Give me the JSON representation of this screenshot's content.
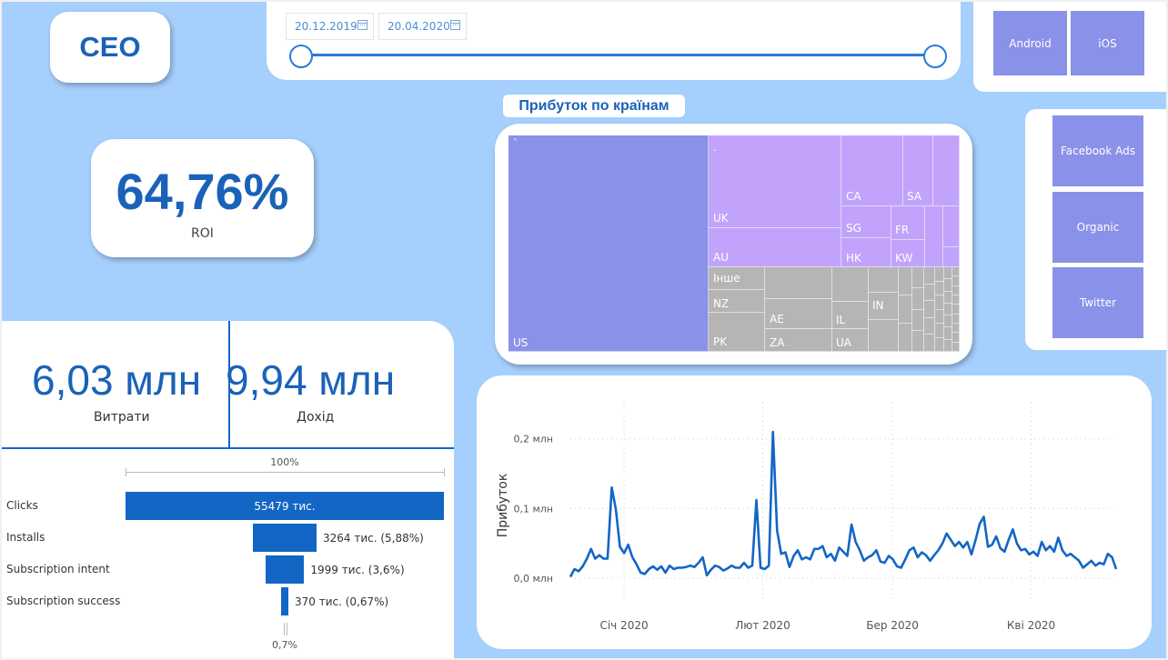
{
  "header": {
    "title": "CEO"
  },
  "date_filter": {
    "start": "20.12.2019",
    "end": "20.04.2020"
  },
  "platform_filter": {
    "options": [
      "Android",
      "iOS"
    ]
  },
  "channel_filter": {
    "options": [
      "Facebook Ads",
      "Organic",
      "Twitter"
    ]
  },
  "roi": {
    "value": "64,76%",
    "label": "ROI"
  },
  "treemap": {
    "title": "Прибуток по країнам",
    "labels": {
      "us": "US",
      "uk": "UK",
      "au": "AU",
      "ca": "CA",
      "sa": "SA",
      "sg": "SG",
      "fr": "FR",
      "hk": "HK",
      "kw": "KW",
      "other": "Інше",
      "nz": "NZ",
      "pk": "PK",
      "ae": "AE",
      "za": "ZA",
      "il": "IL",
      "ua": "UA",
      "in": "IN",
      "tick1": "`",
      "tick2": "."
    },
    "colors": {
      "group1": "#8a91e8",
      "group2": "#c1a3fb",
      "group3": "#b5b5b5"
    }
  },
  "kpis": {
    "spend": {
      "value": "6,03 млн",
      "label": "Витрати"
    },
    "revenue": {
      "value": "9,94 млн",
      "label": "Дохід"
    }
  },
  "funnel": {
    "top_percent": "100%",
    "bottom_percent": "0,7%",
    "stages": [
      {
        "label": "Clicks",
        "value_text": "55479 тис.",
        "share": 1.0
      },
      {
        "label": "Installs",
        "value_text": "3264 тис. (5,88%)",
        "share": 0.0588
      },
      {
        "label": "Subscription intent",
        "value_text": "1999 тис. (3,6%)",
        "share": 0.036
      },
      {
        "label": "Subscription success",
        "value_text": "370 тис. (0,67%)",
        "share": 0.0067
      }
    ]
  },
  "chart_data": {
    "type": "line",
    "title": "",
    "xlabel": "",
    "ylabel": "Прибуток",
    "x_range": [
      "2019-12-20",
      "2020-04-20"
    ],
    "x_ticks": [
      "Січ 2020",
      "Лют 2020",
      "Бер 2020",
      "Кві 2020"
    ],
    "y_ticks": [
      "0,0 млн",
      "0,1 млн",
      "0,2 млн"
    ],
    "ylim": [
      0,
      0.21
    ],
    "grid": true,
    "series": [
      {
        "values": [
          0.002,
          0.013,
          0.01,
          0.017,
          0.028,
          0.042,
          0.028,
          0.033,
          0.028,
          0.028,
          0.13,
          0.099,
          0.045,
          0.036,
          0.048,
          0.03,
          0.02,
          0.008,
          0.006,
          0.013,
          0.017,
          0.012,
          0.017,
          0.008,
          0.018,
          0.013,
          0.015,
          0.015,
          0.016,
          0.018,
          0.016,
          0.022,
          0.03,
          0.004,
          0.012,
          0.018,
          0.016,
          0.011,
          0.014,
          0.018,
          0.015,
          0.015,
          0.022,
          0.015,
          0.018,
          0.112,
          0.015,
          0.013,
          0.018,
          0.21,
          0.068,
          0.035,
          0.037,
          0.016,
          0.032,
          0.04,
          0.027,
          0.03,
          0.027,
          0.042,
          0.042,
          0.046,
          0.03,
          0.035,
          0.025,
          0.044,
          0.038,
          0.032,
          0.077,
          0.052,
          0.04,
          0.025,
          0.03,
          0.033,
          0.04,
          0.024,
          0.022,
          0.032,
          0.027,
          0.017,
          0.015,
          0.027,
          0.04,
          0.044,
          0.03,
          0.037,
          0.033,
          0.025,
          0.033,
          0.04,
          0.05,
          0.064,
          0.055,
          0.046,
          0.052,
          0.044,
          0.052,
          0.034,
          0.055,
          0.078,
          0.088,
          0.045,
          0.048,
          0.06,
          0.043,
          0.038,
          0.055,
          0.07,
          0.05,
          0.04,
          0.042,
          0.034,
          0.038,
          0.032,
          0.052,
          0.04,
          0.046,
          0.038,
          0.058,
          0.04,
          0.032,
          0.035,
          0.03,
          0.025,
          0.015,
          0.02,
          0.025,
          0.018,
          0.022,
          0.02,
          0.035,
          0.03,
          0.013
        ],
        "color": "#1366c4"
      }
    ]
  }
}
